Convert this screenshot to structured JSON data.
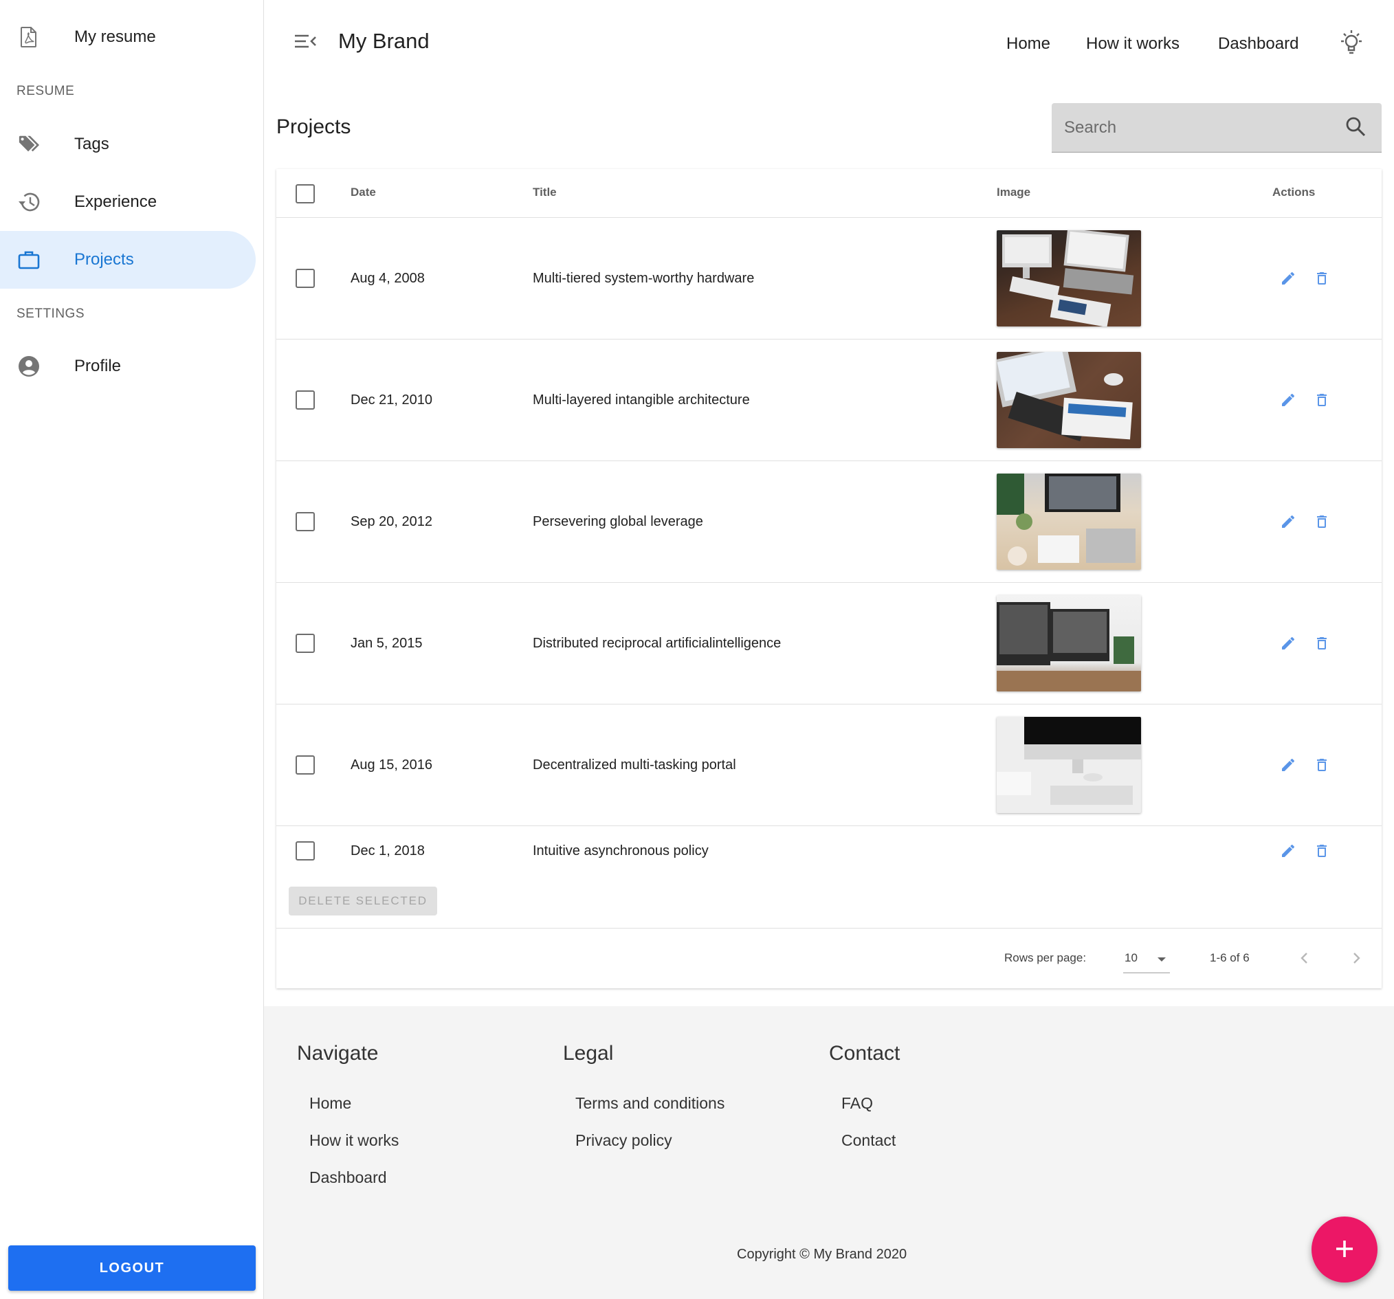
{
  "drawer": {
    "top_item": {
      "label": "My resume",
      "icon": "pdf-file-icon"
    },
    "resume_header": "RESUME",
    "resume_items": [
      {
        "label": "Tags",
        "icon": "tags-icon"
      },
      {
        "label": "Experience",
        "icon": "history-icon"
      },
      {
        "label": "Projects",
        "icon": "briefcase-icon",
        "active": true
      }
    ],
    "settings_header": "SETTINGS",
    "settings_items": [
      {
        "label": "Profile",
        "icon": "account-circle-icon"
      }
    ],
    "logout_label": "LOGOUT"
  },
  "appbar": {
    "brand": "My Brand",
    "nav": [
      "Home",
      "How it works",
      "Dashboard"
    ]
  },
  "page": {
    "title": "Projects",
    "search_placeholder": "Search"
  },
  "table": {
    "columns": {
      "date": "Date",
      "title": "Title",
      "image": "Image",
      "actions": "Actions"
    },
    "rows": [
      {
        "date": "Aug 4, 2008",
        "title": "Multi-tiered system-worthy hardware",
        "has_image": true
      },
      {
        "date": "Dec 21, 2010",
        "title": "Multi-layered intangible architecture",
        "has_image": true
      },
      {
        "date": "Sep 20, 2012",
        "title": "Persevering global leverage",
        "has_image": true
      },
      {
        "date": "Jan 5, 2015",
        "title": "Distributed reciprocal artificialintelligence",
        "has_image": true
      },
      {
        "date": "Aug 15, 2016",
        "title": "Decentralized multi-tasking portal",
        "has_image": true
      },
      {
        "date": "Dec 1, 2018",
        "title": "Intuitive asynchronous policy",
        "has_image": false
      }
    ],
    "delete_selected_label": "DELETE SELECTED",
    "pagination": {
      "rows_per_page_label": "Rows per page:",
      "rows_per_page_value": "10",
      "range": "1-6 of 6"
    }
  },
  "footer": {
    "navigate": {
      "heading": "Navigate",
      "links": [
        "Home",
        "How it works",
        "Dashboard"
      ]
    },
    "legal": {
      "heading": "Legal",
      "links": [
        "Terms and conditions",
        "Privacy policy"
      ]
    },
    "contact": {
      "heading": "Contact",
      "links": [
        "FAQ",
        "Contact"
      ]
    },
    "copyright": "Copyright © My Brand 2020"
  },
  "colors": {
    "accent": "#1976d2",
    "logout": "#1e6ff1",
    "fab": "#ec1766",
    "action_icon": "#5a95e8"
  }
}
